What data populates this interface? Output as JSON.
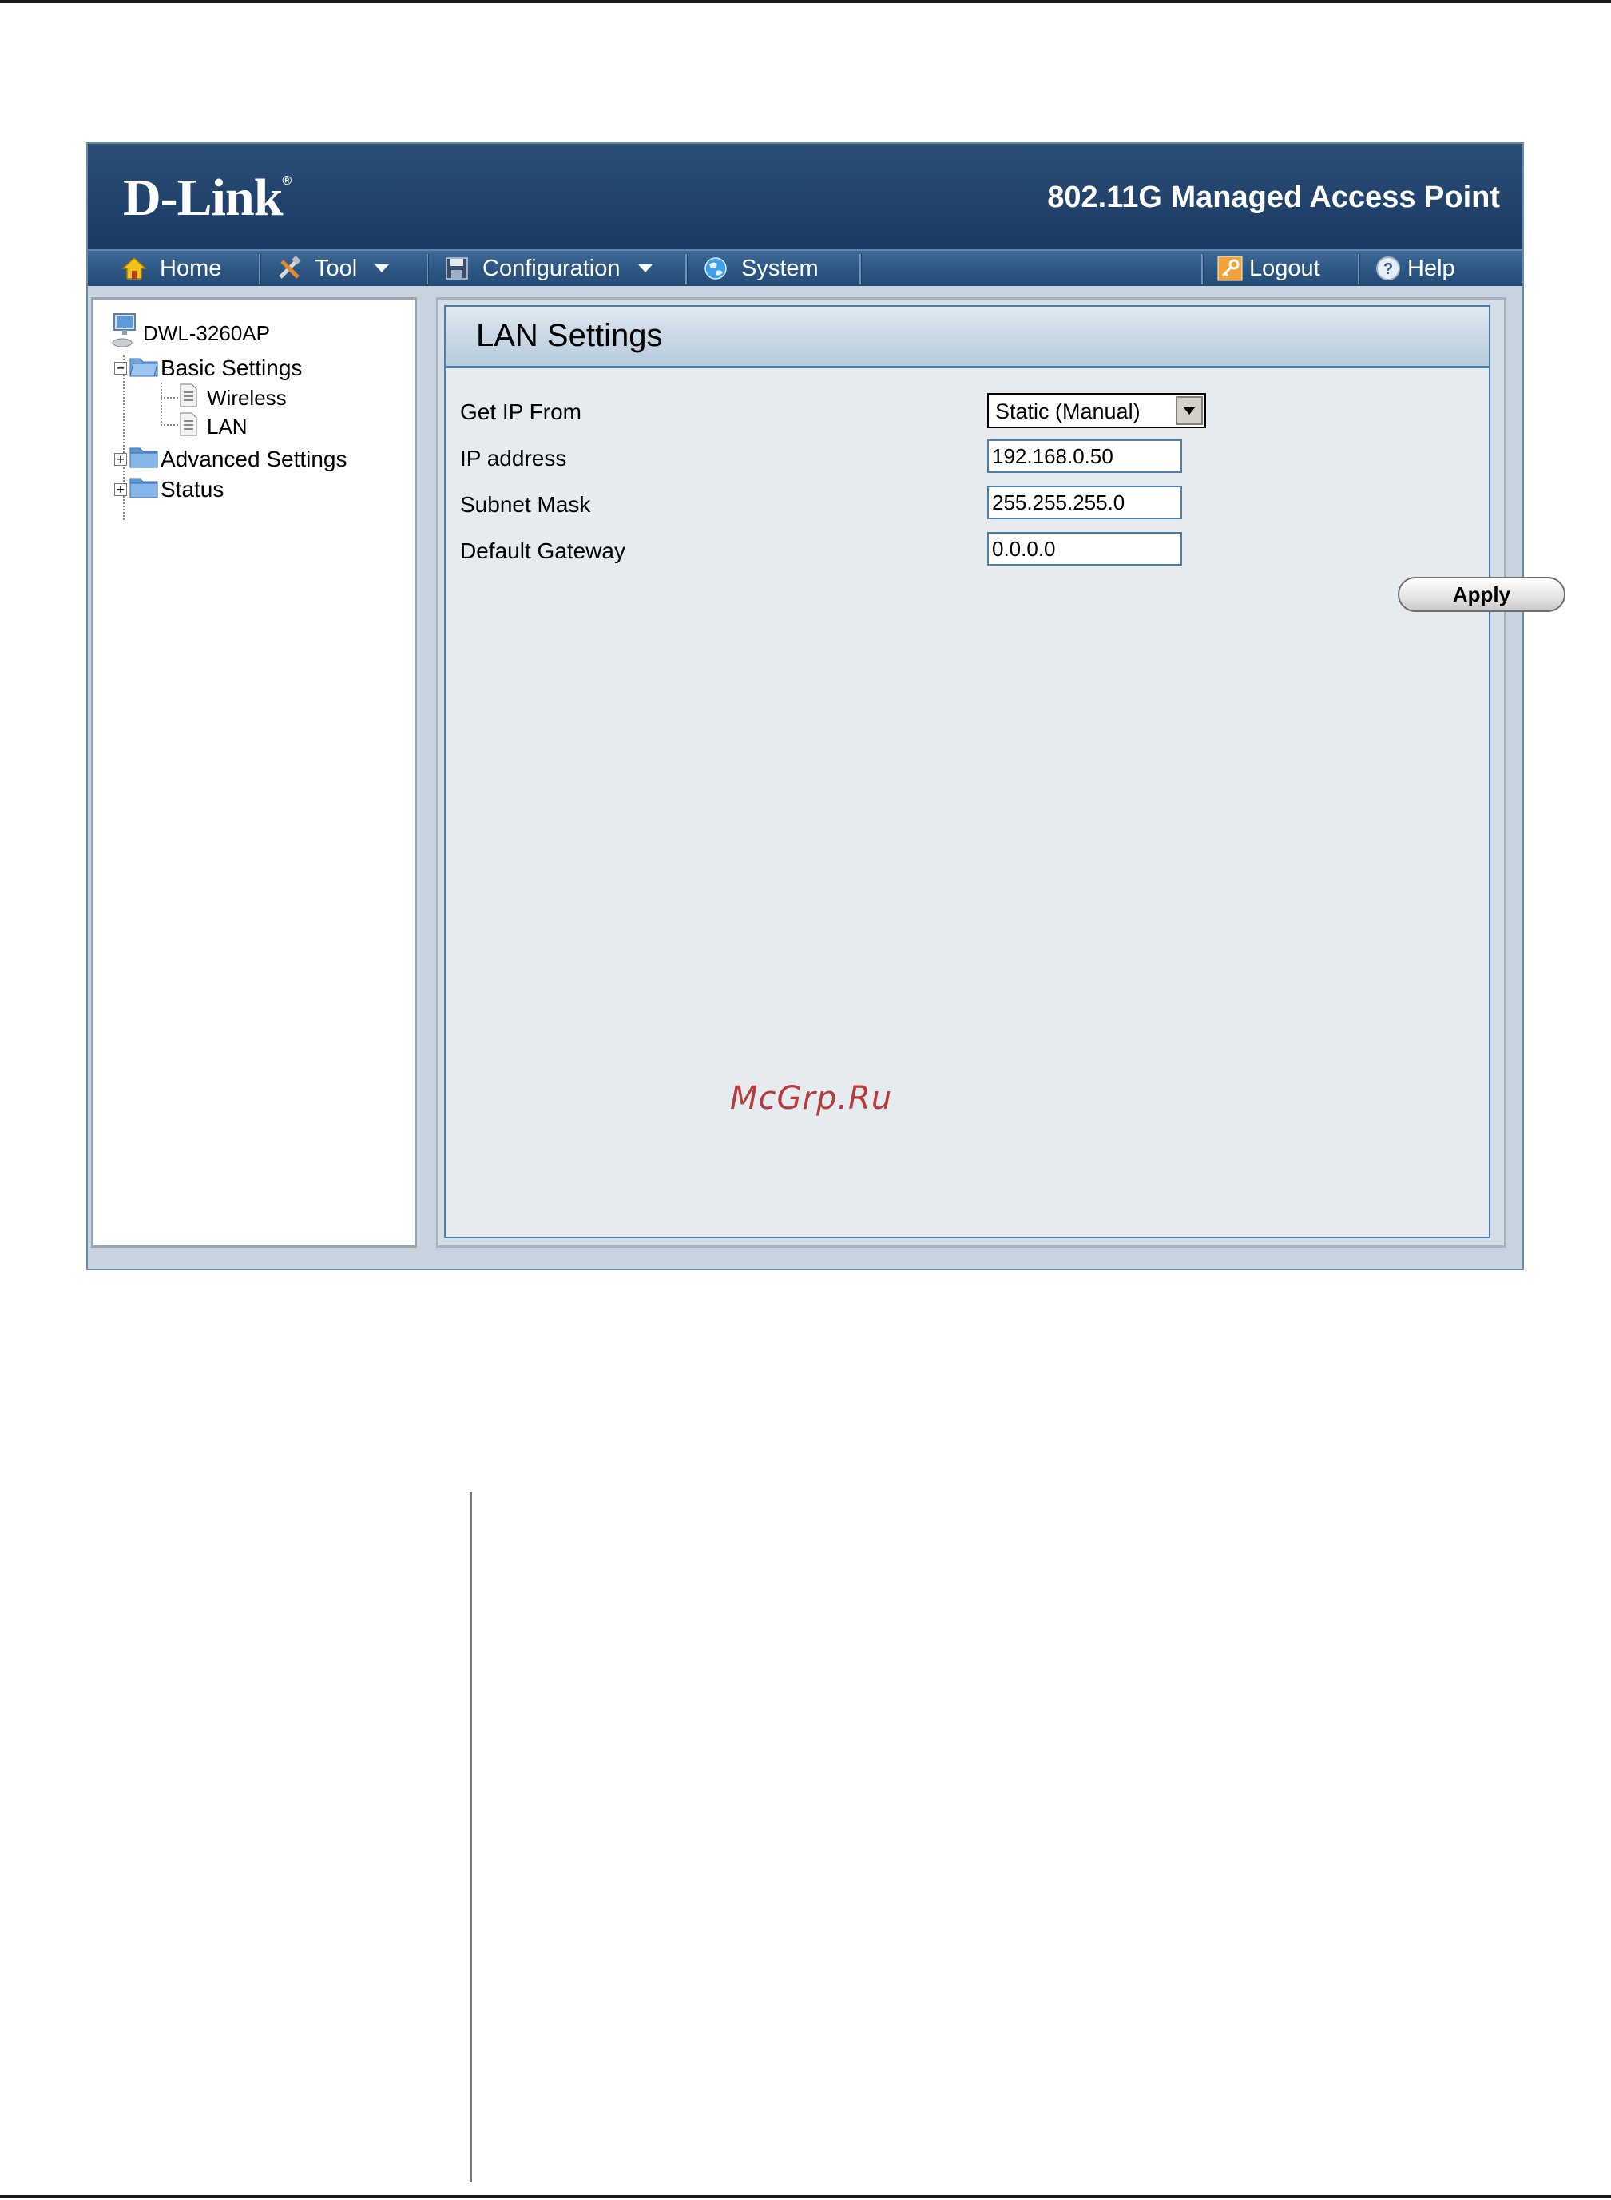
{
  "header": {
    "logo": "D-Link",
    "logo_mark": "®",
    "product_title": "802.11G Managed Access Point"
  },
  "menu": {
    "home": "Home",
    "tool": "Tool",
    "configuration": "Configuration",
    "system": "System",
    "logout": "Logout",
    "help": "Help"
  },
  "tree": {
    "root": "DWL-3260AP",
    "basic_settings": "Basic Settings",
    "wireless": "Wireless",
    "lan": "LAN",
    "advanced_settings": "Advanced Settings",
    "status": "Status"
  },
  "panel": {
    "title": "LAN Settings",
    "get_ip_label": "Get IP From",
    "get_ip_value": "Static (Manual)",
    "ip_label": "IP address",
    "ip_value": "192.168.0.50",
    "mask_label": "Subnet Mask",
    "mask_value": "255.255.255.0",
    "gateway_label": "Default Gateway",
    "gateway_value": "0.0.0.0",
    "apply": "Apply"
  },
  "watermark": "McGrp.Ru"
}
